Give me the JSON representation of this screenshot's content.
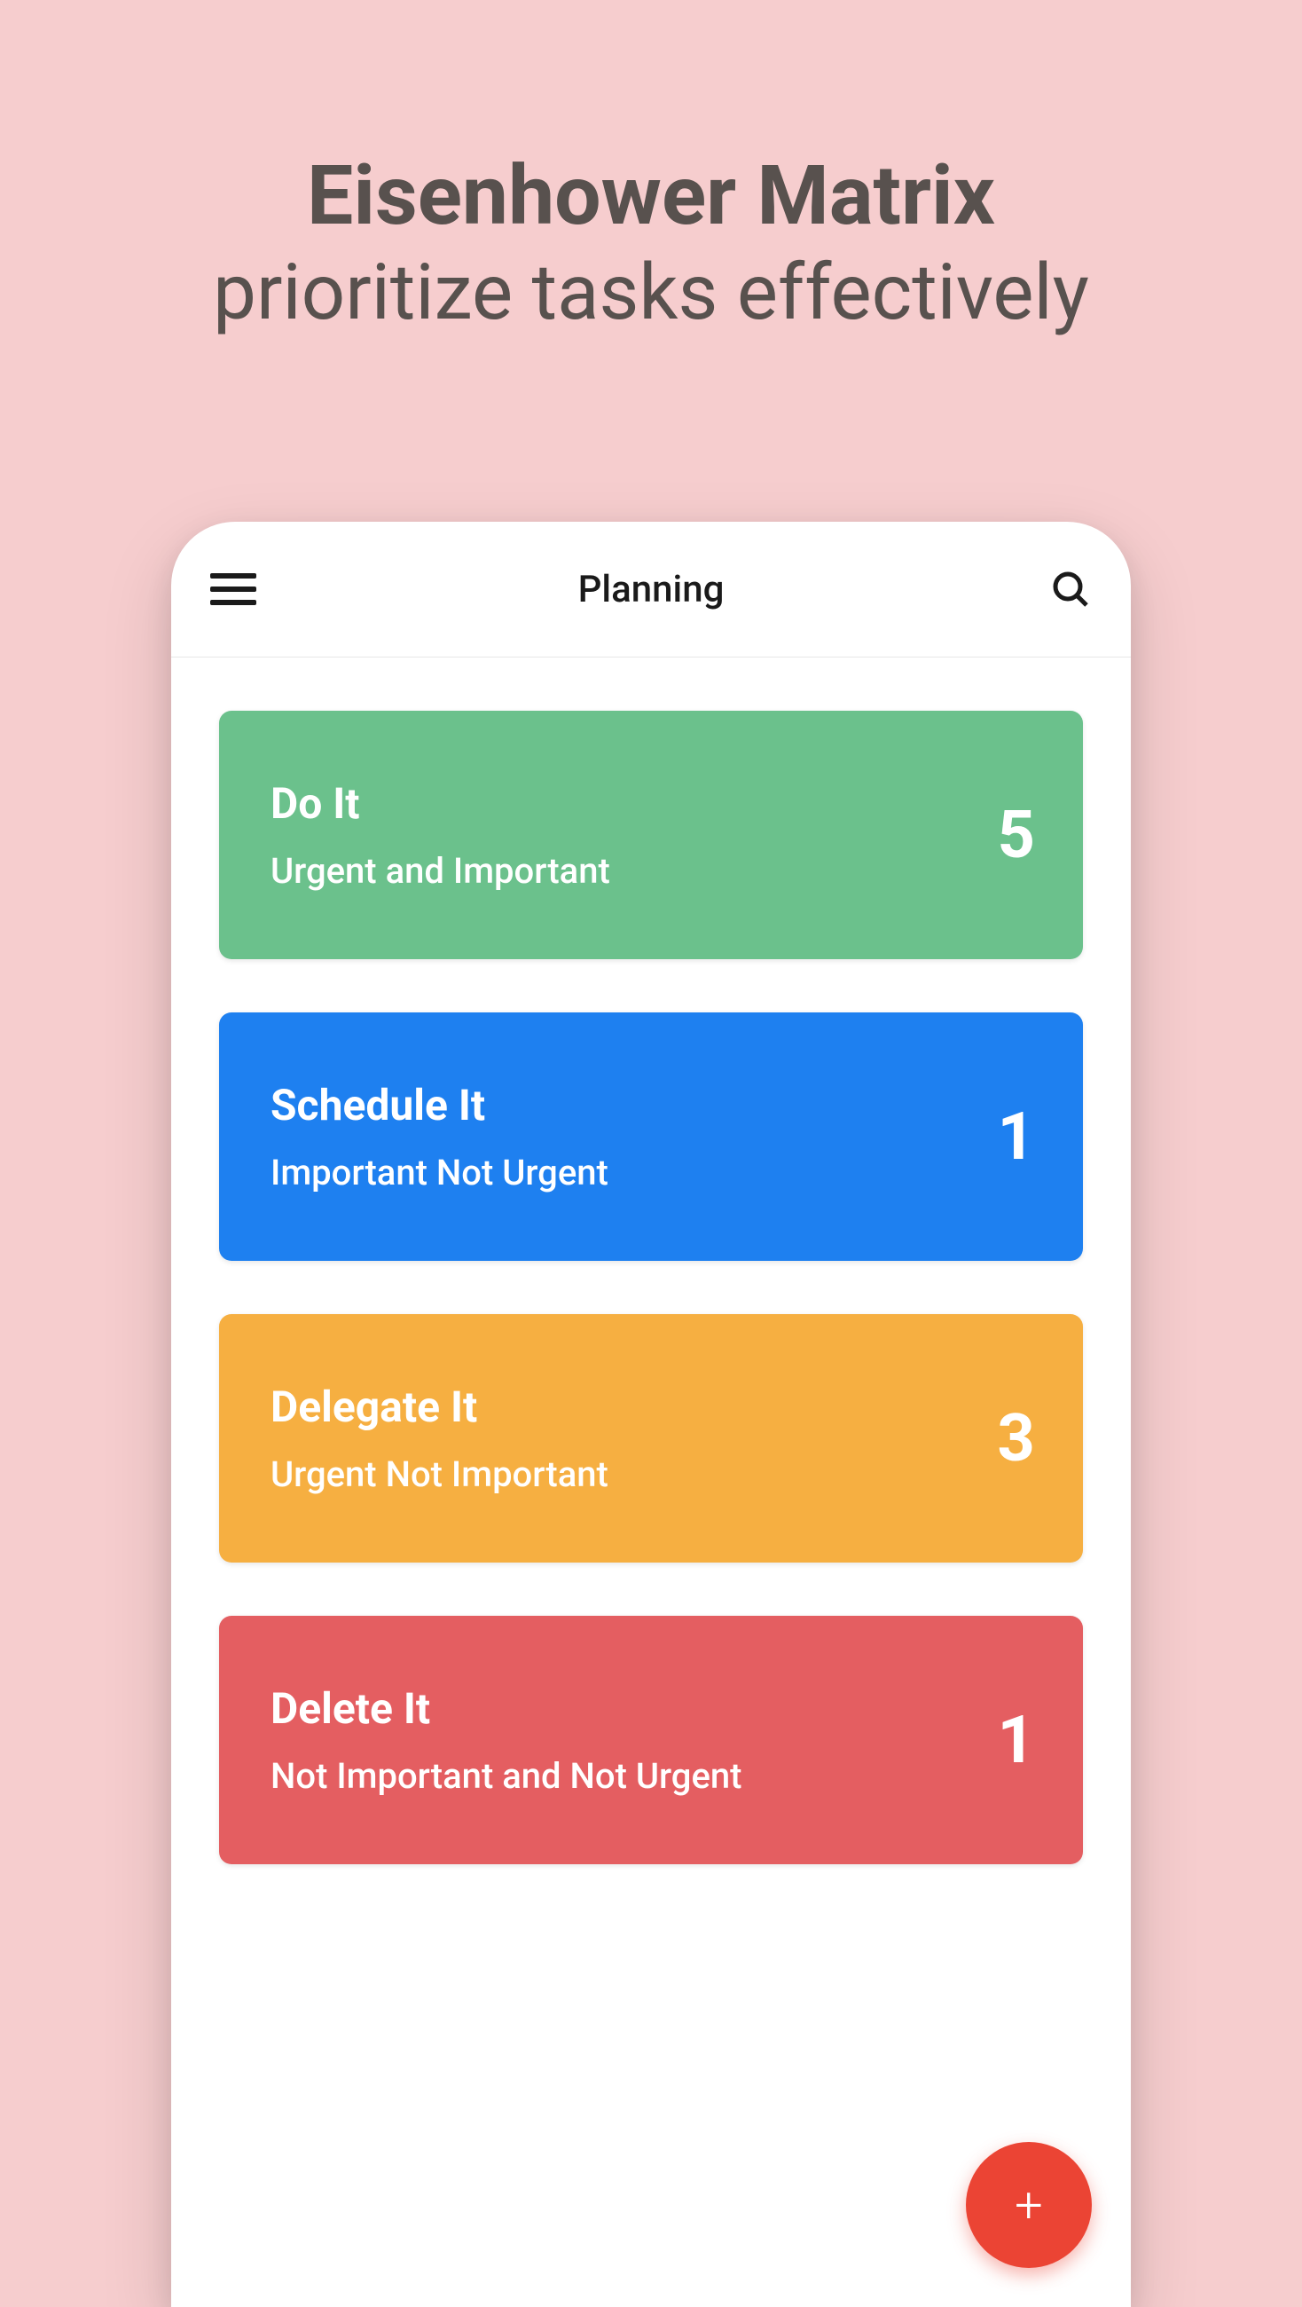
{
  "promo": {
    "title": "Eisenhower Matrix",
    "subtitle": "prioritize tasks effectively"
  },
  "header": {
    "title": "Planning"
  },
  "quadrants": [
    {
      "title": "Do It",
      "subtitle": "Urgent and Important",
      "count": "5",
      "color": "#6BC18C"
    },
    {
      "title": "Schedule It",
      "subtitle": "Important Not Urgent",
      "count": "1",
      "color": "#1E80F0"
    },
    {
      "title": "Delegate It",
      "subtitle": "Urgent Not Important",
      "count": "3",
      "color": "#F6AF41"
    },
    {
      "title": "Delete It",
      "subtitle": "Not Important and Not Urgent",
      "count": "1",
      "color": "#E45E61"
    }
  ]
}
